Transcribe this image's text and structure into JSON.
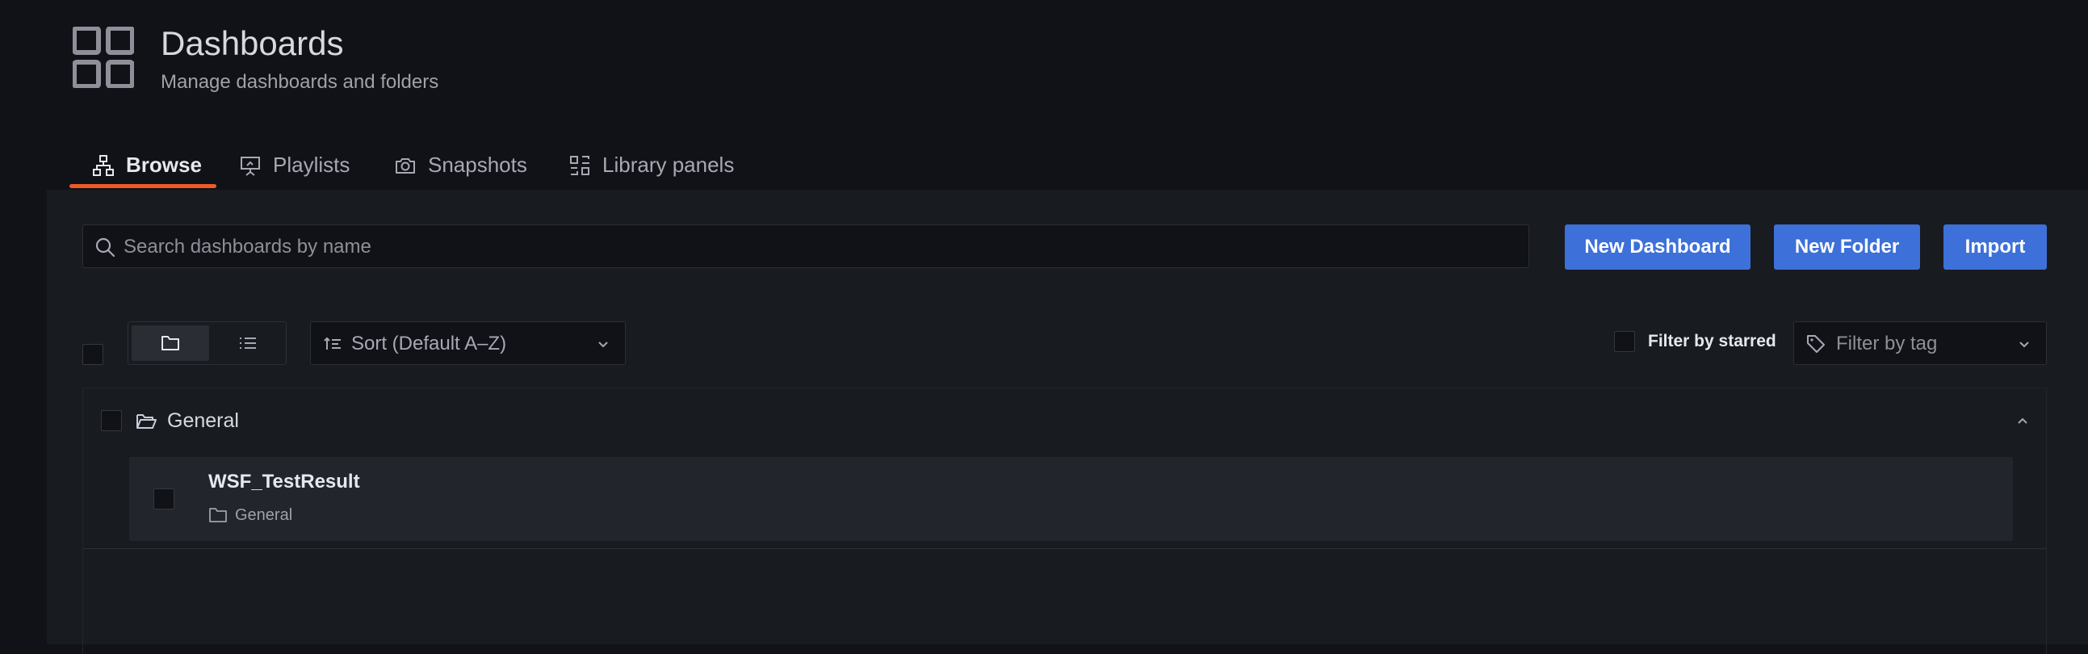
{
  "header": {
    "title": "Dashboards",
    "subtitle": "Manage dashboards and folders",
    "icon": "dashboards-grid-icon"
  },
  "tabs": [
    {
      "label": "Browse",
      "icon": "sitemap-icon",
      "active": true
    },
    {
      "label": "Playlists",
      "icon": "presentation-icon",
      "active": false
    },
    {
      "label": "Snapshots",
      "icon": "camera-icon",
      "active": false
    },
    {
      "label": "Library panels",
      "icon": "library-panels-icon",
      "active": false
    }
  ],
  "search": {
    "placeholder": "Search dashboards by name",
    "value": ""
  },
  "actions": {
    "new_dashboard": "New Dashboard",
    "new_folder": "New Folder",
    "import": "Import"
  },
  "toolbar": {
    "view_mode": "folders",
    "sort_label": "Sort (Default A–Z)",
    "filter_starred_label": "Filter by starred",
    "filter_tag_placeholder": "Filter by tag"
  },
  "folders": [
    {
      "name": "General",
      "expanded": true,
      "dashboards": [
        {
          "title": "WSF_TestResult",
          "folder": "General"
        }
      ]
    }
  ],
  "colors": {
    "background": "#111217",
    "panel": "#181b1f",
    "primary_button": "#3d71d9",
    "active_tab_underline": "#f05a28"
  }
}
